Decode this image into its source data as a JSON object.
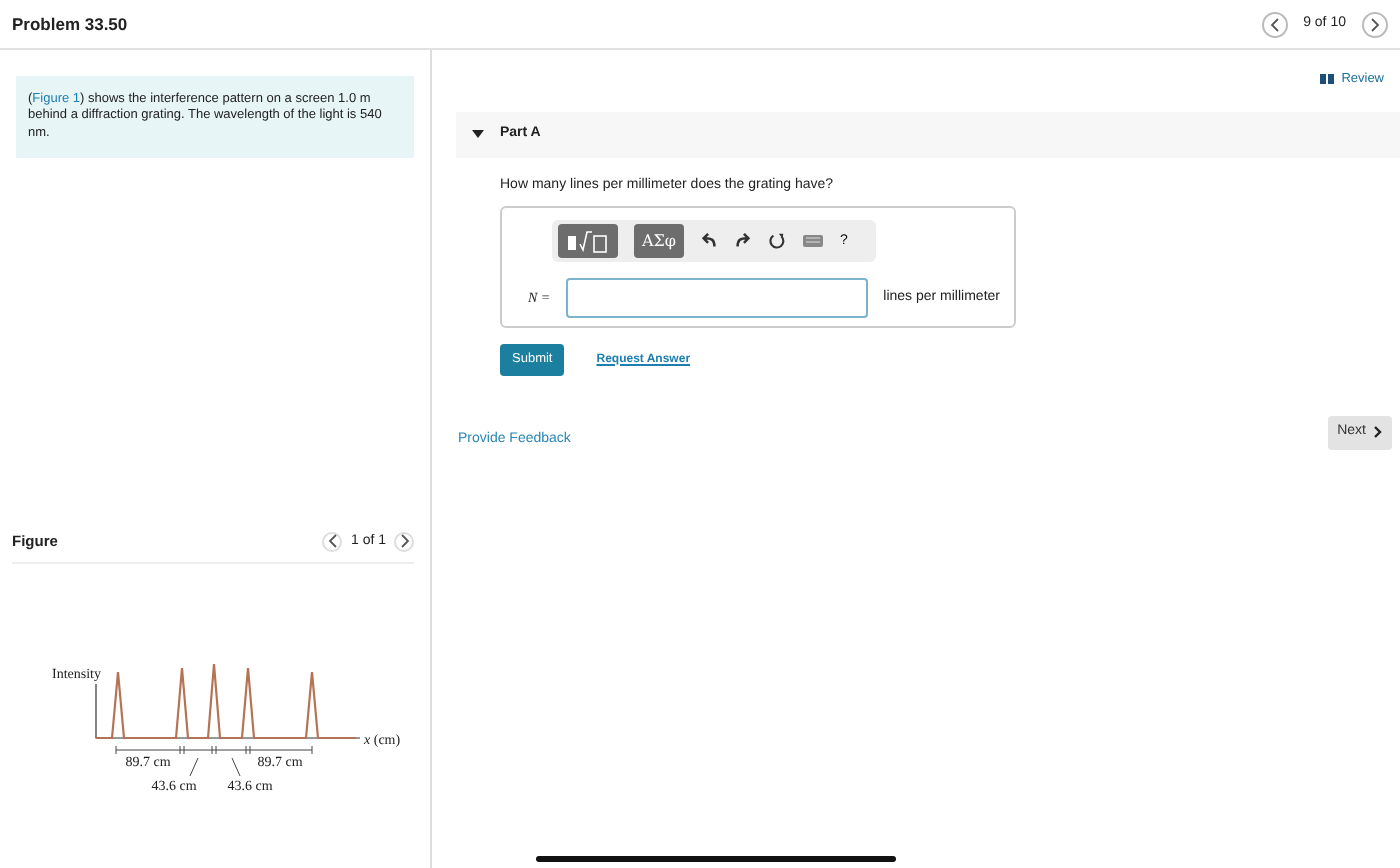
{
  "header": {
    "title": "Problem 33.50",
    "pager": "9 of 10"
  },
  "intro": {
    "before": "(",
    "link": "Figure 1",
    "after": ") shows the interference pattern on a screen 1.0 m behind a diffraction grating. The wavelength of the light is 540 nm."
  },
  "figure": {
    "title": "Figure",
    "pager": "1 of 1",
    "ylabel": "Intensity",
    "xlabel": "*x* (cm)",
    "dims": [
      "89.7 cm",
      "43.6 cm",
      "43.6 cm",
      "89.7 cm"
    ]
  },
  "review": "Review",
  "part": {
    "title": "Part A",
    "expanded": true,
    "question": "How many lines per millimeter does the grating have?",
    "greek_button": "ΑΣφ",
    "help": "?",
    "variable": "N =",
    "units": "lines per millimeter",
    "submit": "Submit",
    "request": "Request Answer"
  },
  "feedback": "Provide Feedback",
  "next": "Next"
}
